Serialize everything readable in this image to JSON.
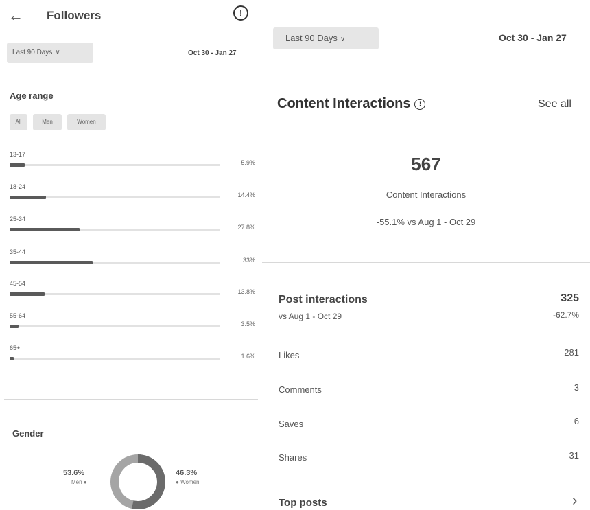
{
  "left": {
    "title": "Followers",
    "date_filter": "Last 90 Days",
    "date_range": "Oct 30 - Jan 27",
    "age_section": {
      "title": "Age range",
      "filters": [
        "All",
        "Men",
        "Women"
      ],
      "rows": [
        {
          "label": "13-17",
          "pct": "5.9%",
          "value": 0.059
        },
        {
          "label": "18-24",
          "pct": "14.4%",
          "value": 0.144
        },
        {
          "label": "25-34",
          "pct": "27.8%",
          "value": 0.278
        },
        {
          "label": "35-44",
          "pct": "33%",
          "value": 0.33
        },
        {
          "label": "45-54",
          "pct": "13.8%",
          "value": 0.138
        },
        {
          "label": "55-64",
          "pct": "3.5%",
          "value": 0.035
        },
        {
          "label": "65+",
          "pct": "1.6%",
          "value": 0.016
        }
      ]
    },
    "gender": {
      "title": "Gender",
      "men_pct": "53.6%",
      "men_label": "Men",
      "women_pct": "46.3%",
      "women_label": "Women"
    }
  },
  "right": {
    "date_filter": "Last 90 Days",
    "date_range": "Oct 30 - Jan 27",
    "title": "Content Interactions",
    "see_all": "See all",
    "total": "567",
    "total_label": "Content Interactions",
    "comparison": "-55.1% vs Aug 1 - Oct 29",
    "post_interactions": {
      "label": "Post interactions",
      "sub": "vs Aug 1 - Oct 29",
      "value": "325",
      "change": "-62.7%"
    },
    "metrics": [
      {
        "label": "Likes",
        "value": "281"
      },
      {
        "label": "Comments",
        "value": "3"
      },
      {
        "label": "Saves",
        "value": "6"
      },
      {
        "label": "Shares",
        "value": "31"
      }
    ],
    "top_posts": "Top posts"
  },
  "icons": {
    "back": "arrow-left-icon",
    "info": "info-icon",
    "chevron_down": "chevron-down-icon",
    "chevron_right": "chevron-right-icon"
  },
  "colors": {
    "bar_fill": "#5a5a5a",
    "men": "#6b6b6b",
    "women": "#a5a5a5"
  }
}
